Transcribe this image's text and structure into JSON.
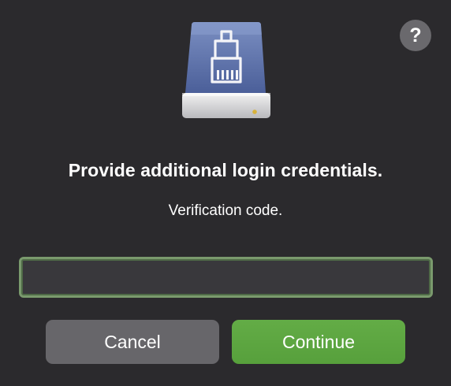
{
  "dialog": {
    "help_label": "?",
    "title": "Provide additional login credentials.",
    "subtitle": "Verification code.",
    "code_field": {
      "value": "",
      "placeholder": ""
    },
    "cancel_label": "Cancel",
    "continue_label": "Continue",
    "icon": "network-drive-icon"
  },
  "colors": {
    "background": "#2b2a2d",
    "accent_green": "#5aa540",
    "field_focus_ring": "#7a9a6d",
    "secondary_button": "#67666a"
  }
}
